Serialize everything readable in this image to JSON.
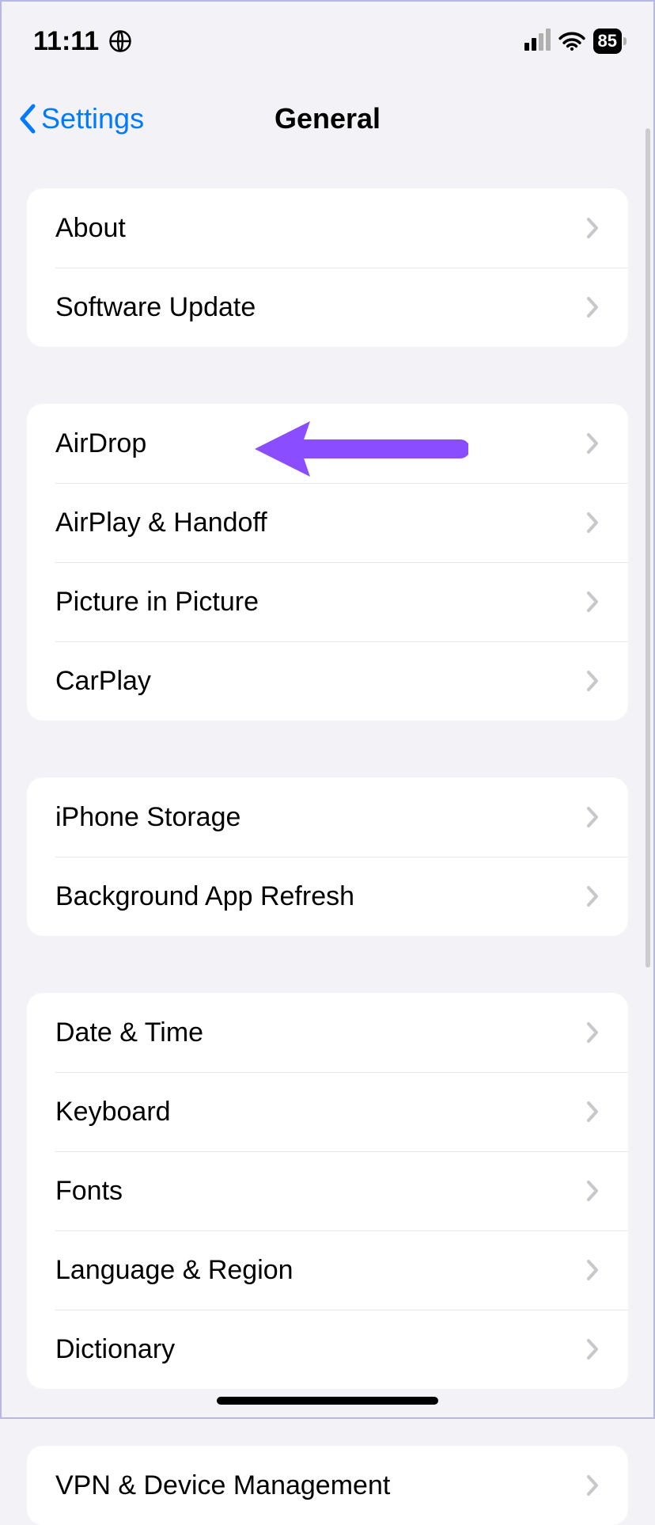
{
  "status": {
    "time": "11:11",
    "battery": "85"
  },
  "nav": {
    "back_label": "Settings",
    "title": "General"
  },
  "groups": [
    {
      "rows": [
        {
          "id": "about",
          "label": "About"
        },
        {
          "id": "software-update",
          "label": "Software Update"
        }
      ]
    },
    {
      "rows": [
        {
          "id": "airdrop",
          "label": "AirDrop"
        },
        {
          "id": "airplay-handoff",
          "label": "AirPlay & Handoff",
          "highlighted": true
        },
        {
          "id": "picture-in-picture",
          "label": "Picture in Picture"
        },
        {
          "id": "carplay",
          "label": "CarPlay"
        }
      ]
    },
    {
      "rows": [
        {
          "id": "iphone-storage",
          "label": "iPhone Storage"
        },
        {
          "id": "background-app-refresh",
          "label": "Background App Refresh"
        }
      ]
    },
    {
      "rows": [
        {
          "id": "date-time",
          "label": "Date & Time"
        },
        {
          "id": "keyboard",
          "label": "Keyboard"
        },
        {
          "id": "fonts",
          "label": "Fonts"
        },
        {
          "id": "language-region",
          "label": "Language & Region"
        },
        {
          "id": "dictionary",
          "label": "Dictionary"
        }
      ]
    },
    {
      "rows": [
        {
          "id": "vpn-device-management",
          "label": "VPN & Device Management"
        }
      ]
    }
  ],
  "annotation": {
    "target": "airplay-handoff",
    "color": "#8a4dff"
  }
}
